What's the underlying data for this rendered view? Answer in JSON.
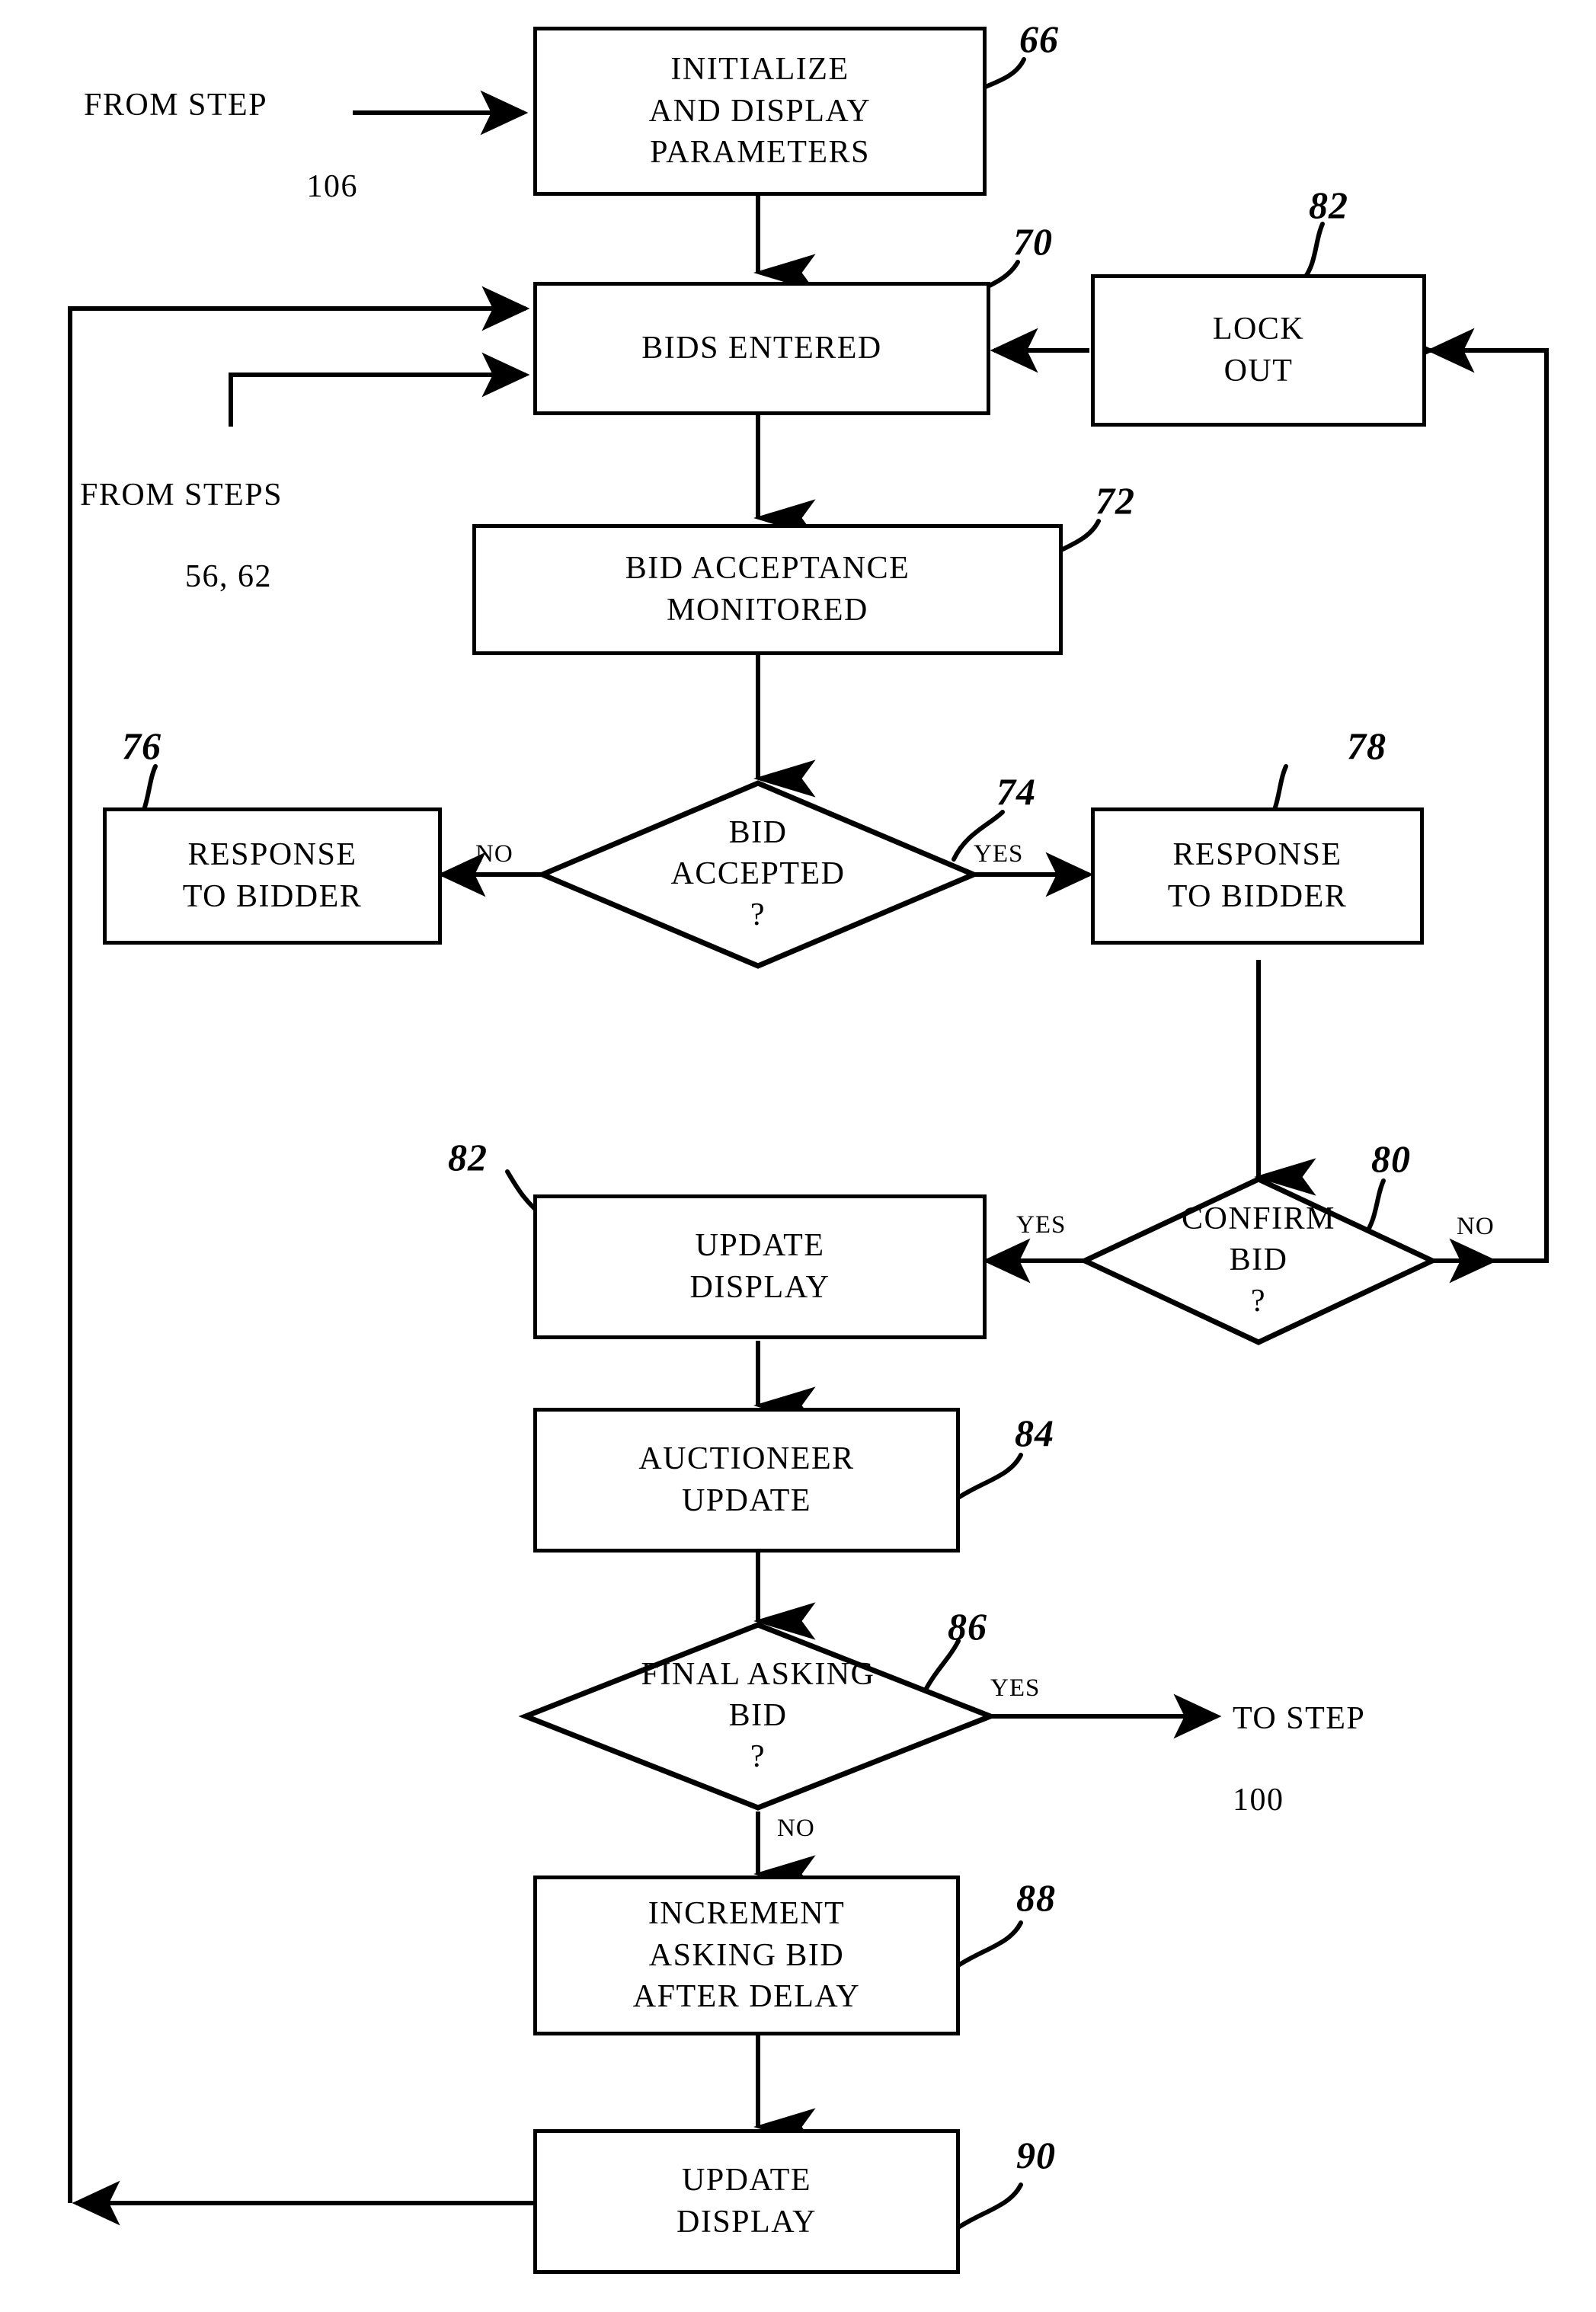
{
  "figure": {
    "type": "patent-flowchart",
    "nodes": [
      {
        "id": "n66",
        "ref": "66",
        "shape": "process",
        "label": "INITIALIZE\nAND  DISPLAY\nPARAMETERS"
      },
      {
        "id": "n70",
        "ref": "70",
        "shape": "process",
        "label": "BIDS  ENTERED"
      },
      {
        "id": "n82lock",
        "ref": "82",
        "shape": "process",
        "label": "LOCK\nOUT"
      },
      {
        "id": "n72",
        "ref": "72",
        "shape": "process",
        "label": "BID  ACCEPTANCE\nMONITORED"
      },
      {
        "id": "n74",
        "ref": "74",
        "shape": "decision",
        "label": "BID\nACCEPTED\n?"
      },
      {
        "id": "n76",
        "ref": "76",
        "shape": "process",
        "label": "RESPONSE\nTO  BIDDER"
      },
      {
        "id": "n78",
        "ref": "78",
        "shape": "process",
        "label": "RESPONSE\nTO  BIDDER"
      },
      {
        "id": "n80",
        "ref": "80",
        "shape": "decision",
        "label": "CONFIRM\nBID\n?"
      },
      {
        "id": "n82upd",
        "ref": "82",
        "shape": "process",
        "label": "UPDATE\nDISPLAY"
      },
      {
        "id": "n84",
        "ref": "84",
        "shape": "process",
        "label": "AUCTIONEER\nUPDATE"
      },
      {
        "id": "n86",
        "ref": "86",
        "shape": "decision",
        "label": "FINAL  ASKING\nBID\n?"
      },
      {
        "id": "n88",
        "ref": "88",
        "shape": "process",
        "label": "INCREMENT\nASKING  BID\nAFTER  DELAY"
      },
      {
        "id": "n90",
        "ref": "90",
        "shape": "process",
        "label": "UPDATE\nDISPLAY"
      }
    ],
    "connectors": [
      {
        "from": "external",
        "to": "n66",
        "label": ""
      },
      {
        "from": "n66",
        "to": "n70",
        "label": ""
      },
      {
        "from": "n82lock",
        "to": "n70",
        "label": ""
      },
      {
        "from": "n70",
        "to": "n72",
        "label": ""
      },
      {
        "from": "n72",
        "to": "n74",
        "label": ""
      },
      {
        "from": "n74",
        "to": "n76",
        "label": "NO"
      },
      {
        "from": "n74",
        "to": "n78",
        "label": "YES"
      },
      {
        "from": "n78",
        "to": "n80",
        "label": ""
      },
      {
        "from": "n80",
        "to": "n82upd",
        "label": "YES"
      },
      {
        "from": "n80",
        "to": "n82lock",
        "label": "NO"
      },
      {
        "from": "n82upd",
        "to": "n84",
        "label": ""
      },
      {
        "from": "n84",
        "to": "n86",
        "label": ""
      },
      {
        "from": "n86",
        "to": "external",
        "label": "YES"
      },
      {
        "from": "n86",
        "to": "n88",
        "label": "NO"
      },
      {
        "from": "n88",
        "to": "n90",
        "label": ""
      },
      {
        "from": "n90",
        "to": "n70",
        "label": ""
      }
    ],
    "entry_labels": [
      {
        "id": "from_step_106",
        "line1": "FROM STEP",
        "line2": "106"
      },
      {
        "id": "from_steps_56_62",
        "line1": "FROM STEPS",
        "line2": "56,  62"
      }
    ],
    "exit_labels": [
      {
        "id": "to_step_100",
        "line1": "TO STEP",
        "line2": "100"
      }
    ],
    "edge_labels": {
      "bid_accepted_no": "NO",
      "bid_accepted_yes": "YES",
      "confirm_bid_yes": "YES",
      "confirm_bid_no": "NO",
      "final_asking_bid_yes": "YES",
      "final_asking_bid_no": "NO"
    },
    "reference_numerals": {
      "initialize": "66",
      "bids_entered": "70",
      "lock_out": "82",
      "bid_acceptance_monitored": "72",
      "bid_accepted": "74",
      "response_to_bidder_no": "76",
      "response_to_bidder_yes": "78",
      "confirm_bid": "80",
      "update_display_mid": "82",
      "auctioneer_update": "84",
      "final_asking_bid": "86",
      "increment_asking_bid": "88",
      "update_display_bottom": "90"
    },
    "colors": {
      "line": "#000000",
      "background": "#ffffff",
      "text": "#000000"
    }
  }
}
